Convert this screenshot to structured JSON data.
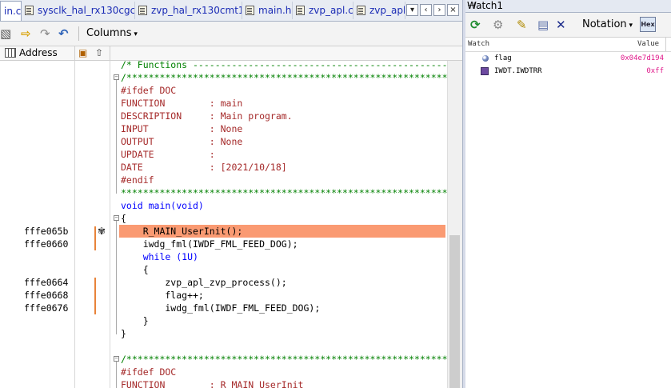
{
  "tabs": [
    {
      "label": "in.c",
      "active": true
    },
    {
      "label": "sysclk_hal_rx130cgc.c"
    },
    {
      "label": "zvp_hal_rx130cmt1.c"
    },
    {
      "label": "main.h"
    },
    {
      "label": "zvp_apl.c"
    },
    {
      "label": "zvp_apl.h"
    }
  ],
  "tab_nav": {
    "menu": "▾",
    "prev": "‹",
    "next": "›",
    "close": "×"
  },
  "toolbar": {
    "columns_label": "Columns"
  },
  "columns": {
    "address": "Address"
  },
  "code_lines": [
    {
      "addr": "",
      "text": "/* Functions ----------------------------------------------------",
      "cls": "cm"
    },
    {
      "addr": "",
      "text": "/*****************************************************************",
      "cls": "cm"
    },
    {
      "addr": "",
      "text": "#ifdef DOC",
      "cls": "pp"
    },
    {
      "addr": "",
      "text": "FUNCTION        : main",
      "cls": "pp"
    },
    {
      "addr": "",
      "text": "DESCRIPTION     : Main program.",
      "cls": "pp"
    },
    {
      "addr": "",
      "text": "INPUT           : None",
      "cls": "pp"
    },
    {
      "addr": "",
      "text": "OUTPUT          : None",
      "cls": "pp"
    },
    {
      "addr": "",
      "text": "UPDATE          :",
      "cls": "pp"
    },
    {
      "addr": "",
      "text": "DATE            : [2021/10/18]",
      "cls": "pp"
    },
    {
      "addr": "",
      "text": "#endif",
      "cls": "pp"
    },
    {
      "addr": "",
      "text": "*****************************************************************",
      "cls": "cm"
    },
    {
      "addr": "",
      "text": "void main(void)",
      "cls": "kwline"
    },
    {
      "addr": "",
      "text": "{",
      "cls": ""
    },
    {
      "addr": "fffe065b",
      "text": "    R_MAIN_UserInit();",
      "cls": "hl"
    },
    {
      "addr": "fffe0660",
      "text": "    iwdg_fml(IWDF_FML_FEED_DOG);",
      "cls": ""
    },
    {
      "addr": "",
      "text": "    while (1U)",
      "cls": "while"
    },
    {
      "addr": "",
      "text": "    {",
      "cls": ""
    },
    {
      "addr": "fffe0664",
      "text": "        zvp_apl_zvp_process();",
      "cls": ""
    },
    {
      "addr": "fffe0668",
      "text": "        flag++;",
      "cls": ""
    },
    {
      "addr": "fffe0676",
      "text": "        iwdg_fml(IWDF_FML_FEED_DOG);",
      "cls": ""
    },
    {
      "addr": "",
      "text": "    }",
      "cls": ""
    },
    {
      "addr": "",
      "text": "}",
      "cls": ""
    },
    {
      "addr": "",
      "text": "",
      "cls": ""
    },
    {
      "addr": "",
      "text": "/*****************************************************************",
      "cls": "cm"
    },
    {
      "addr": "",
      "text": "#ifdef DOC",
      "cls": "pp"
    },
    {
      "addr": "",
      "text": "FUNCTION        : R_MAIN_UserInit",
      "cls": "pp"
    }
  ],
  "watch": {
    "title": "Watch1",
    "notation_label": "Notation",
    "hex_label": "Hex",
    "header": {
      "name": "Watch",
      "value": "Value"
    },
    "rows": [
      {
        "name": "flag",
        "value": "0x04e7d194",
        "type": "var"
      },
      {
        "name": "IWDT.IWDTRR",
        "value": "0xff",
        "type": "reg"
      }
    ]
  }
}
